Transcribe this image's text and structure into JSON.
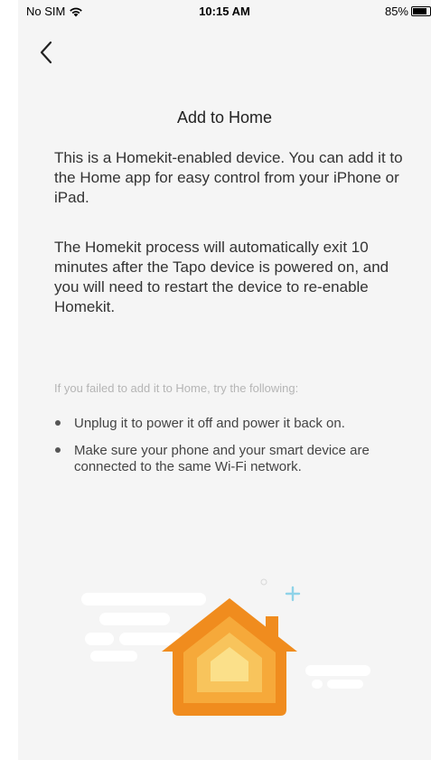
{
  "status_bar": {
    "carrier": "No SIM",
    "time": "10:15 AM",
    "battery": "85%",
    "battery_level": 0.85
  },
  "header": {
    "back_icon": "chevron-left-icon",
    "title": "Add to Home"
  },
  "content": {
    "intro": "This is a Homekit-enabled device. You can add it to the Home app for easy control from your iPhone or iPad.",
    "process": "The Homekit process will automatically exit 10 minutes after the Tapo device is powered on, and you will need to restart the device to re-enable Homekit.",
    "hint": "If you failed to add it to Home, try the following:",
    "tips": [
      "Unplug it to power it off and power it back on.",
      "Make sure your phone and your smart device are connected to the same Wi-Fi network."
    ]
  },
  "illustration": {
    "icon": "home-house-icon",
    "colors": {
      "outer": "#f08c1e",
      "layer2": "#f6a93a",
      "layer3": "#f8c45c",
      "inner": "#fbe08a",
      "sparkle": "#8fd3e8"
    }
  }
}
